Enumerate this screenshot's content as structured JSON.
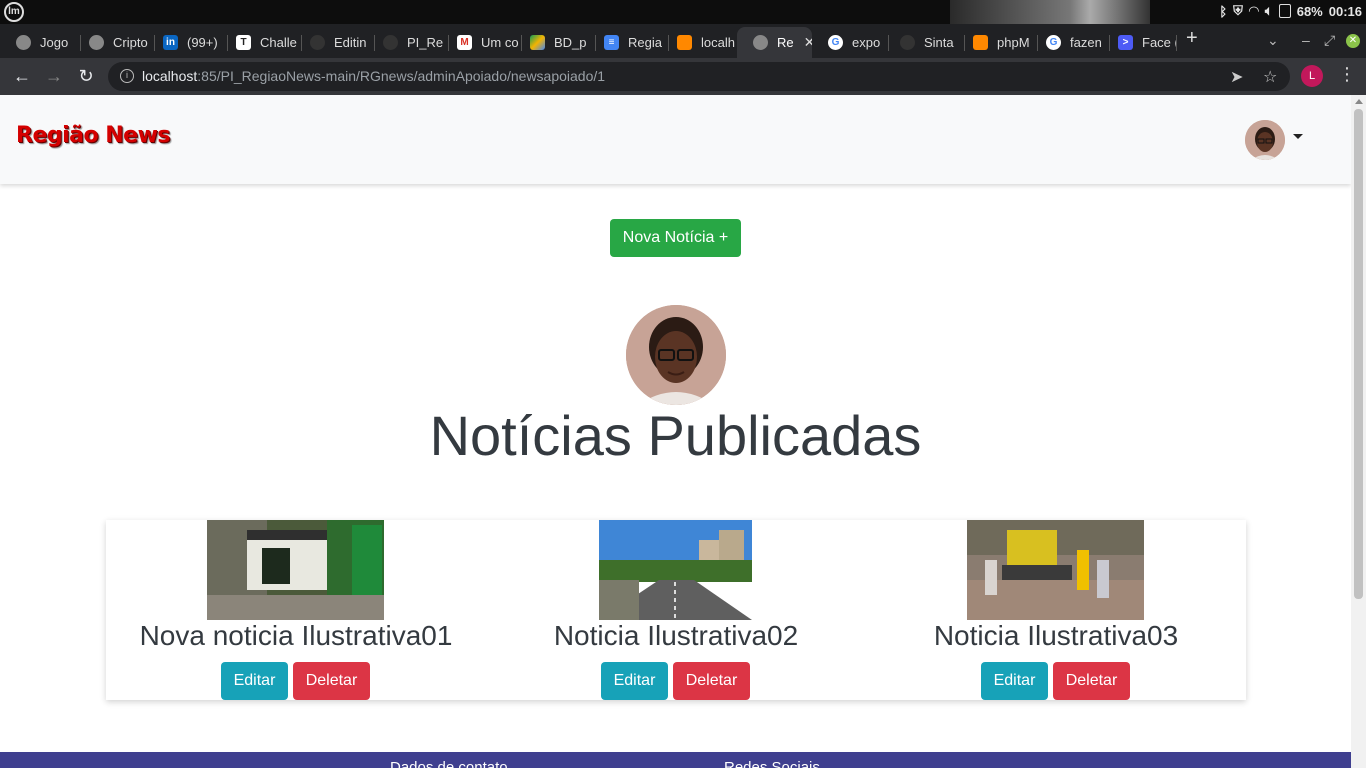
{
  "os": {
    "logo": "lm",
    "battery": "68%",
    "clock": "00:16"
  },
  "tabs": [
    {
      "label": "Jogo",
      "icon": "globe-icon"
    },
    {
      "label": "Cripto",
      "icon": "globe-icon"
    },
    {
      "label": "(99+)",
      "icon": "linkedin-icon"
    },
    {
      "label": "Challe",
      "icon": "trello-icon"
    },
    {
      "label": "Editin",
      "icon": "github-icon"
    },
    {
      "label": "PI_Re",
      "icon": "github-icon"
    },
    {
      "label": "Um co",
      "icon": "gmail-icon"
    },
    {
      "label": "BD_p",
      "icon": "drive-icon"
    },
    {
      "label": "Regia",
      "icon": "docs-icon"
    },
    {
      "label": "localh",
      "icon": "xampp-icon"
    },
    {
      "label": "Re",
      "icon": "globe-icon",
      "active": true
    },
    {
      "label": "expo",
      "icon": "google-icon"
    },
    {
      "label": "Sinta",
      "icon": "github-icon"
    },
    {
      "label": "phpM",
      "icon": "xampp-icon"
    },
    {
      "label": "fazen",
      "icon": "google-icon"
    },
    {
      "label": "Face (",
      "icon": "terminal-icon"
    }
  ],
  "address": {
    "host": "localhost",
    "rest": ":85/PI_RegiaoNews-main/RGnews/adminApoiado/newsapoiado/1",
    "profile_initial": "L"
  },
  "site": {
    "brand": "Região News",
    "new_news_button": "Nova Notícia +",
    "page_title": "Notícias Publicadas",
    "edit_label": "Editar",
    "delete_label": "Deletar",
    "news": [
      {
        "title": "Nova noticia Ilustrativa01"
      },
      {
        "title": "Noticia Ilustrativa02"
      },
      {
        "title": "Noticia Ilustrativa03"
      }
    ],
    "footer": {
      "contact": "Dados de contato",
      "social": "Redes Sociais"
    }
  },
  "colors": {
    "success": "#28a745",
    "info": "#17a2b8",
    "danger": "#dc3545",
    "brand_red": "#d40000",
    "footer": "#3f3f8f"
  }
}
